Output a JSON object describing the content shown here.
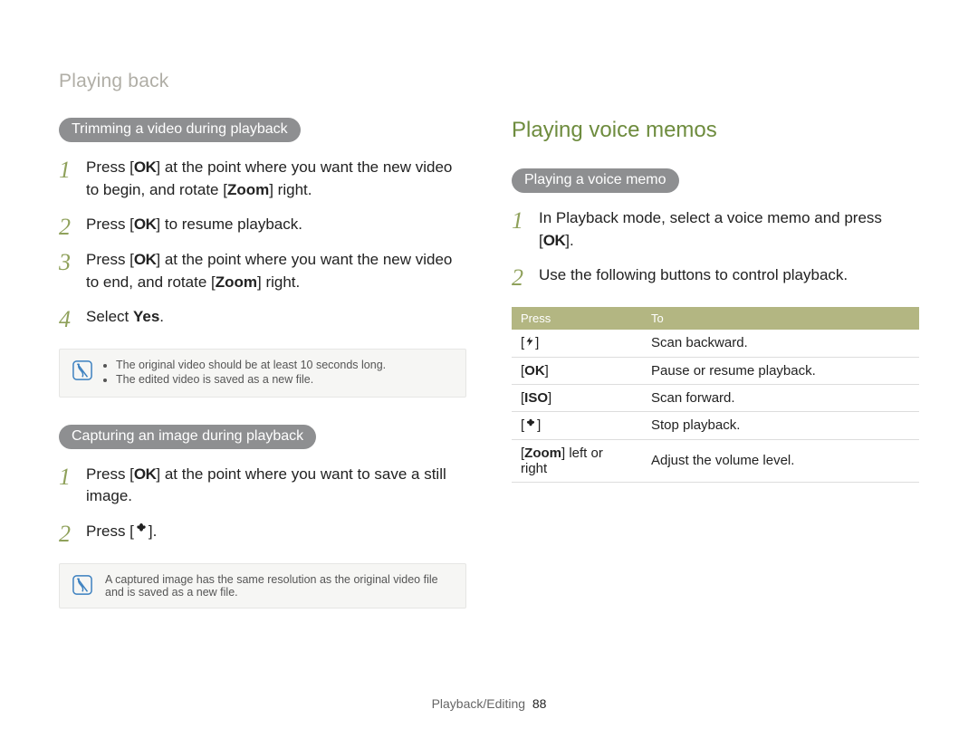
{
  "breadcrumb": "Playing back",
  "left": {
    "section1": {
      "pill": "Trimming a video during playback",
      "steps": [
        {
          "num": "1",
          "pre": "Press [",
          "key": "OK",
          "post": "] at the point where you want the new video to begin, and rotate [",
          "bold2": "Zoom",
          "post2": "] right."
        },
        {
          "num": "2",
          "pre": "Press [",
          "key": "OK",
          "post": "] to resume playback."
        },
        {
          "num": "3",
          "pre": "Press [",
          "key": "OK",
          "post": "] at the point where you want the new video to end, and rotate [",
          "bold2": "Zoom",
          "post2": "] right."
        },
        {
          "num": "4",
          "pre": "Select ",
          "bold": "Yes",
          "post": "."
        }
      ],
      "notes": [
        "The original video should be at least 10 seconds long.",
        "The edited video is saved as a new file."
      ]
    },
    "section2": {
      "pill": "Capturing an image during playback",
      "steps": [
        {
          "num": "1",
          "pre": "Press [",
          "key": "OK",
          "post": "] at the point where you want to save a still image."
        },
        {
          "num": "2",
          "pre": "Press [",
          "icon": "flower",
          "post": "]."
        }
      ],
      "note": "A captured image has the same resolution as the original video file and is saved as a new file."
    }
  },
  "right": {
    "heading": "Playing voice memos",
    "pill": "Playing a voice memo",
    "steps": [
      {
        "num": "1",
        "pre": "In Playback mode, select a voice memo and press [",
        "key": "OK",
        "post": "]."
      },
      {
        "num": "2",
        "text": "Use the following buttons to control playback."
      }
    ],
    "table": {
      "head": {
        "c1": "Press",
        "c2": "To"
      },
      "rows": [
        {
          "key_icon": "flash",
          "desc": "Scan backward."
        },
        {
          "key_text": "OK",
          "key_bold": true,
          "desc": "Pause or resume playback."
        },
        {
          "key_text": "ISO",
          "key_bold": true,
          "desc": "Scan forward."
        },
        {
          "key_icon": "flower",
          "desc": "Stop playback."
        },
        {
          "key_compound_pre": "[",
          "key_compound_bold": "Zoom",
          "key_compound_post": "] left or right",
          "desc": "Adjust the volume level."
        }
      ]
    }
  },
  "footer": {
    "section": "Playback/Editing",
    "page": "88"
  }
}
